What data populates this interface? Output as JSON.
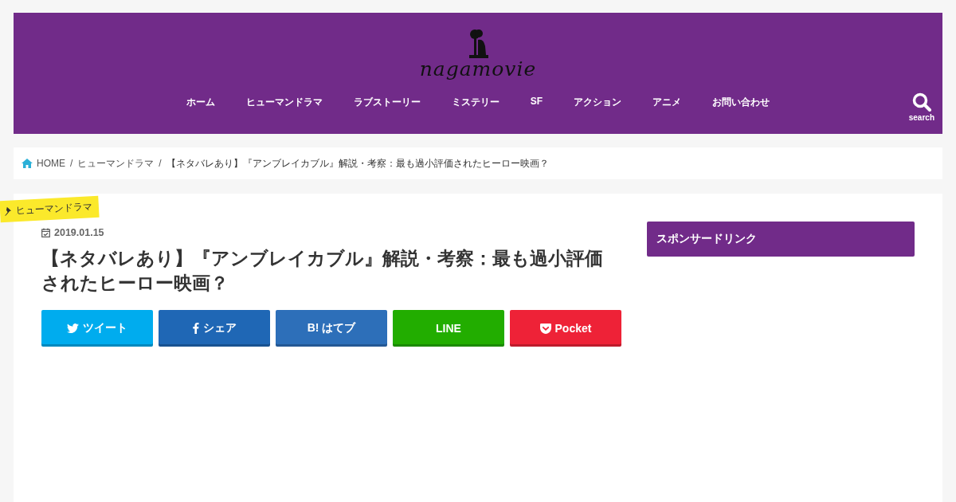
{
  "header": {
    "logo": "nagamovie",
    "nav": [
      {
        "label": "ホーム"
      },
      {
        "label": "ヒューマンドラマ"
      },
      {
        "label": "ラブストーリー"
      },
      {
        "label": "ミステリー"
      },
      {
        "label": "SF"
      },
      {
        "label": "アクション"
      },
      {
        "label": "アニメ"
      },
      {
        "label": "お問い合わせ"
      }
    ],
    "search_label": "search"
  },
  "breadcrumb": {
    "separator": "/",
    "items": [
      "HOME",
      "ヒューマンドラマ",
      "【ネタバレあり】『アンブレイカブル』解説・考察：最も過小評価されたヒーロー映画？"
    ]
  },
  "article": {
    "category": "ヒューマンドラマ",
    "date": "2019.01.15",
    "title": "【ネタバレあり】『アンブレイカブル』解説・考察：最も過小評価されたヒーロー映画？",
    "share_buttons": [
      {
        "kind": "twitter",
        "label": "ツイート",
        "color": "#00acee"
      },
      {
        "kind": "facebook",
        "label": "シェア",
        "color": "#1f67b5"
      },
      {
        "kind": "hatena",
        "label": "B! はてブ",
        "color": "#2d6fb9"
      },
      {
        "kind": "line",
        "label": "LINE",
        "color": "#22ad00"
      },
      {
        "kind": "pocket",
        "label": "Pocket",
        "color": "#ee2237"
      }
    ]
  },
  "sidebar": {
    "heading": "スポンサードリンク"
  }
}
